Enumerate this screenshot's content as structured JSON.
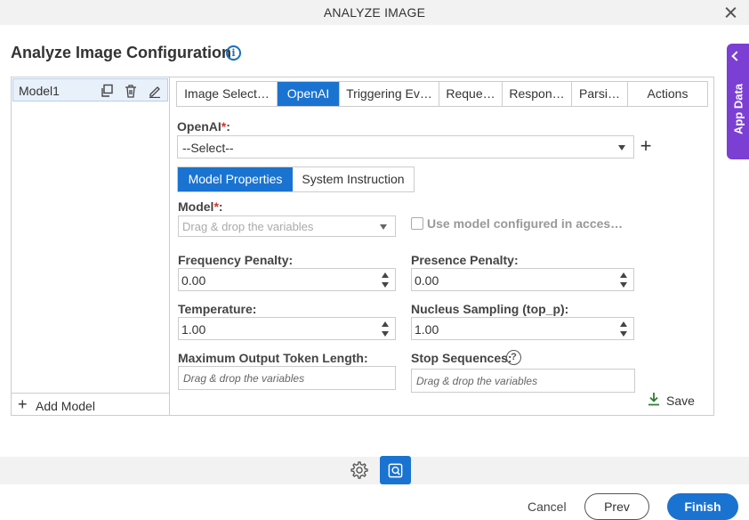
{
  "window": {
    "title": "ANALYZE IMAGE"
  },
  "page": {
    "heading": "Analyze Image Configuration"
  },
  "side_tab": {
    "label": "App Data"
  },
  "models": {
    "items": [
      {
        "label": "Model1"
      }
    ],
    "add_label": "Add Model"
  },
  "tabs": [
    {
      "label": "Image Select…",
      "active": false
    },
    {
      "label": "OpenAI",
      "active": true
    },
    {
      "label": "Triggering Ev…",
      "active": false
    },
    {
      "label": "Reque…",
      "active": false
    },
    {
      "label": "Respon…",
      "active": false
    },
    {
      "label": "Parsi…",
      "active": false
    },
    {
      "label": "Actions",
      "active": false
    }
  ],
  "openai": {
    "label": "OpenAI",
    "required_mark": "*",
    "colon": ":",
    "selected": "--Select--"
  },
  "subtabs": [
    {
      "label": "Model Properties",
      "active": true
    },
    {
      "label": "System Instruction",
      "active": false
    }
  ],
  "model_field": {
    "label": "Model",
    "required_mark": "*",
    "colon": ":",
    "placeholder": "Drag & drop the variables"
  },
  "use_model_checkbox": {
    "label": "Use model configured in acces…",
    "checked": false
  },
  "fields": {
    "frequency_penalty": {
      "label": "Frequency Penalty:",
      "value": "0.00"
    },
    "presence_penalty": {
      "label": "Presence Penalty:",
      "value": "0.00"
    },
    "temperature": {
      "label": "Temperature:",
      "value": "1.00"
    },
    "nucleus_sampling": {
      "label": "Nucleus Sampling (top_p):",
      "value": "1.00"
    },
    "max_tokens": {
      "label": "Maximum Output Token Length:",
      "placeholder": "Drag & drop the variables"
    },
    "stop_sequences": {
      "label": "Stop Sequences:",
      "placeholder": "Drag & drop the variables"
    }
  },
  "save_label": "Save",
  "footer": {
    "cancel": "Cancel",
    "prev": "Prev",
    "finish": "Finish"
  },
  "colors": {
    "accent": "#1a73d0",
    "side_tab": "#7c3fd4",
    "required": "#d93025",
    "save_icon": "#2e7d32"
  }
}
